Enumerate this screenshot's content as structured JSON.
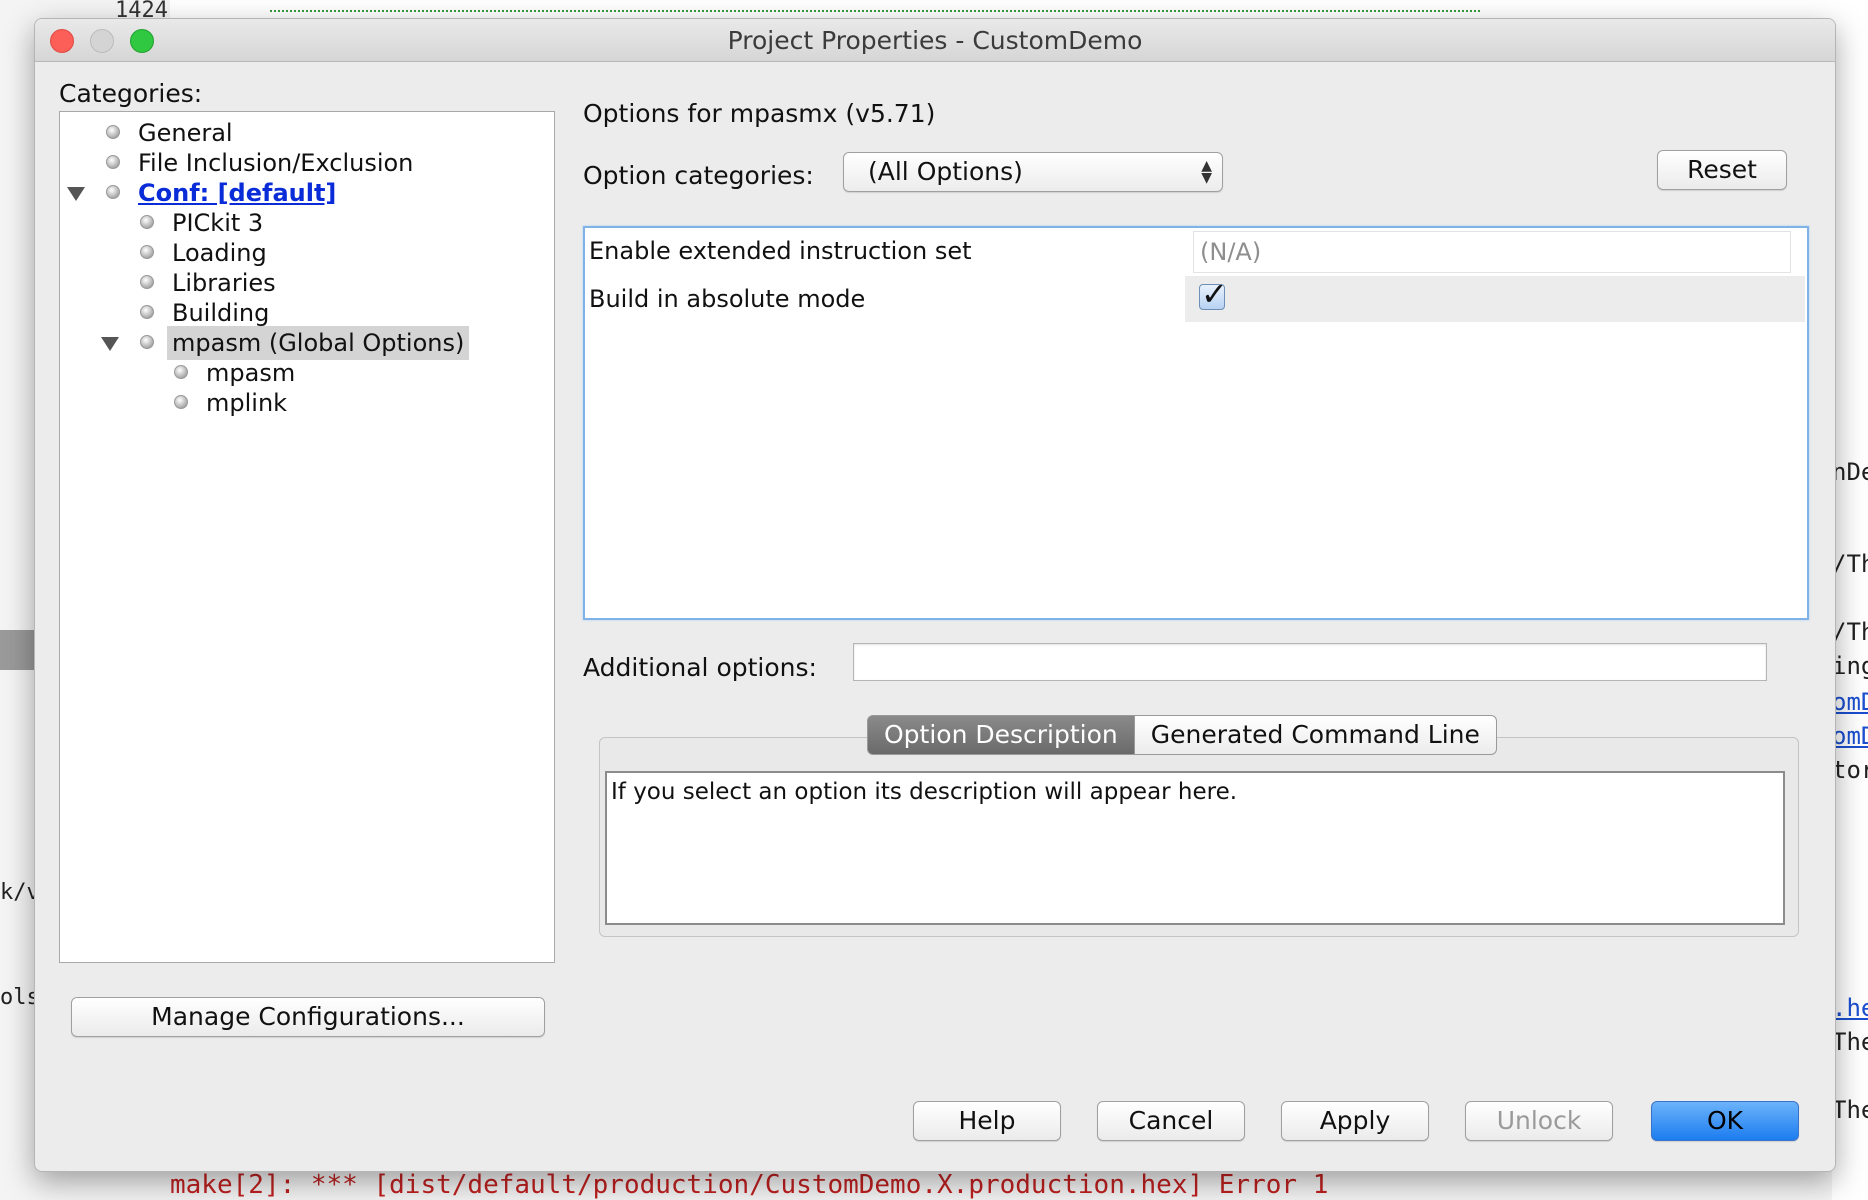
{
  "background": {
    "line_number": "1424",
    "left_snippets": [
      "k/v3",
      "ols."
    ],
    "right_snippets": [
      "nDe",
      "/Th",
      "/Th",
      "ing",
      "omD",
      "omD",
      "tor",
      ".he",
      "The",
      "The"
    ],
    "bottom_error": "make[2]: *** [dist/default/production/CustomDemo.X.production.hex] Error 1"
  },
  "window": {
    "title": "Project Properties - CustomDemo"
  },
  "sidebar": {
    "heading": "Categories:",
    "items": [
      {
        "label": "General"
      },
      {
        "label": "File Inclusion/Exclusion"
      },
      {
        "label": "Conf: [default]"
      },
      {
        "label": "PICkit 3"
      },
      {
        "label": "Loading"
      },
      {
        "label": "Libraries"
      },
      {
        "label": "Building"
      },
      {
        "label": "mpasm (Global Options)"
      },
      {
        "label": "mpasm"
      },
      {
        "label": "mplink"
      }
    ],
    "manage_button": "Manage Configurations..."
  },
  "main": {
    "heading": "Options for mpasmx (v5.71)",
    "option_categories_label": "Option categories:",
    "option_categories_value": "(All Options)",
    "reset_button": "Reset",
    "options": [
      {
        "label": "Enable extended instruction set",
        "value": "(N/A)"
      },
      {
        "label": "Build in absolute mode",
        "value": "checked"
      }
    ],
    "additional_options_label": "Additional options:",
    "additional_options_value": "",
    "tabs": [
      "Option Description",
      "Generated Command Line"
    ],
    "description": "If you select an option its description will appear here."
  },
  "footer": {
    "help": "Help",
    "cancel": "Cancel",
    "apply": "Apply",
    "unlock": "Unlock",
    "ok": "OK"
  },
  "colors": {
    "accent": "#1c7cf0",
    "link": "#0a2cd8",
    "selection": "#d4d4d4"
  }
}
